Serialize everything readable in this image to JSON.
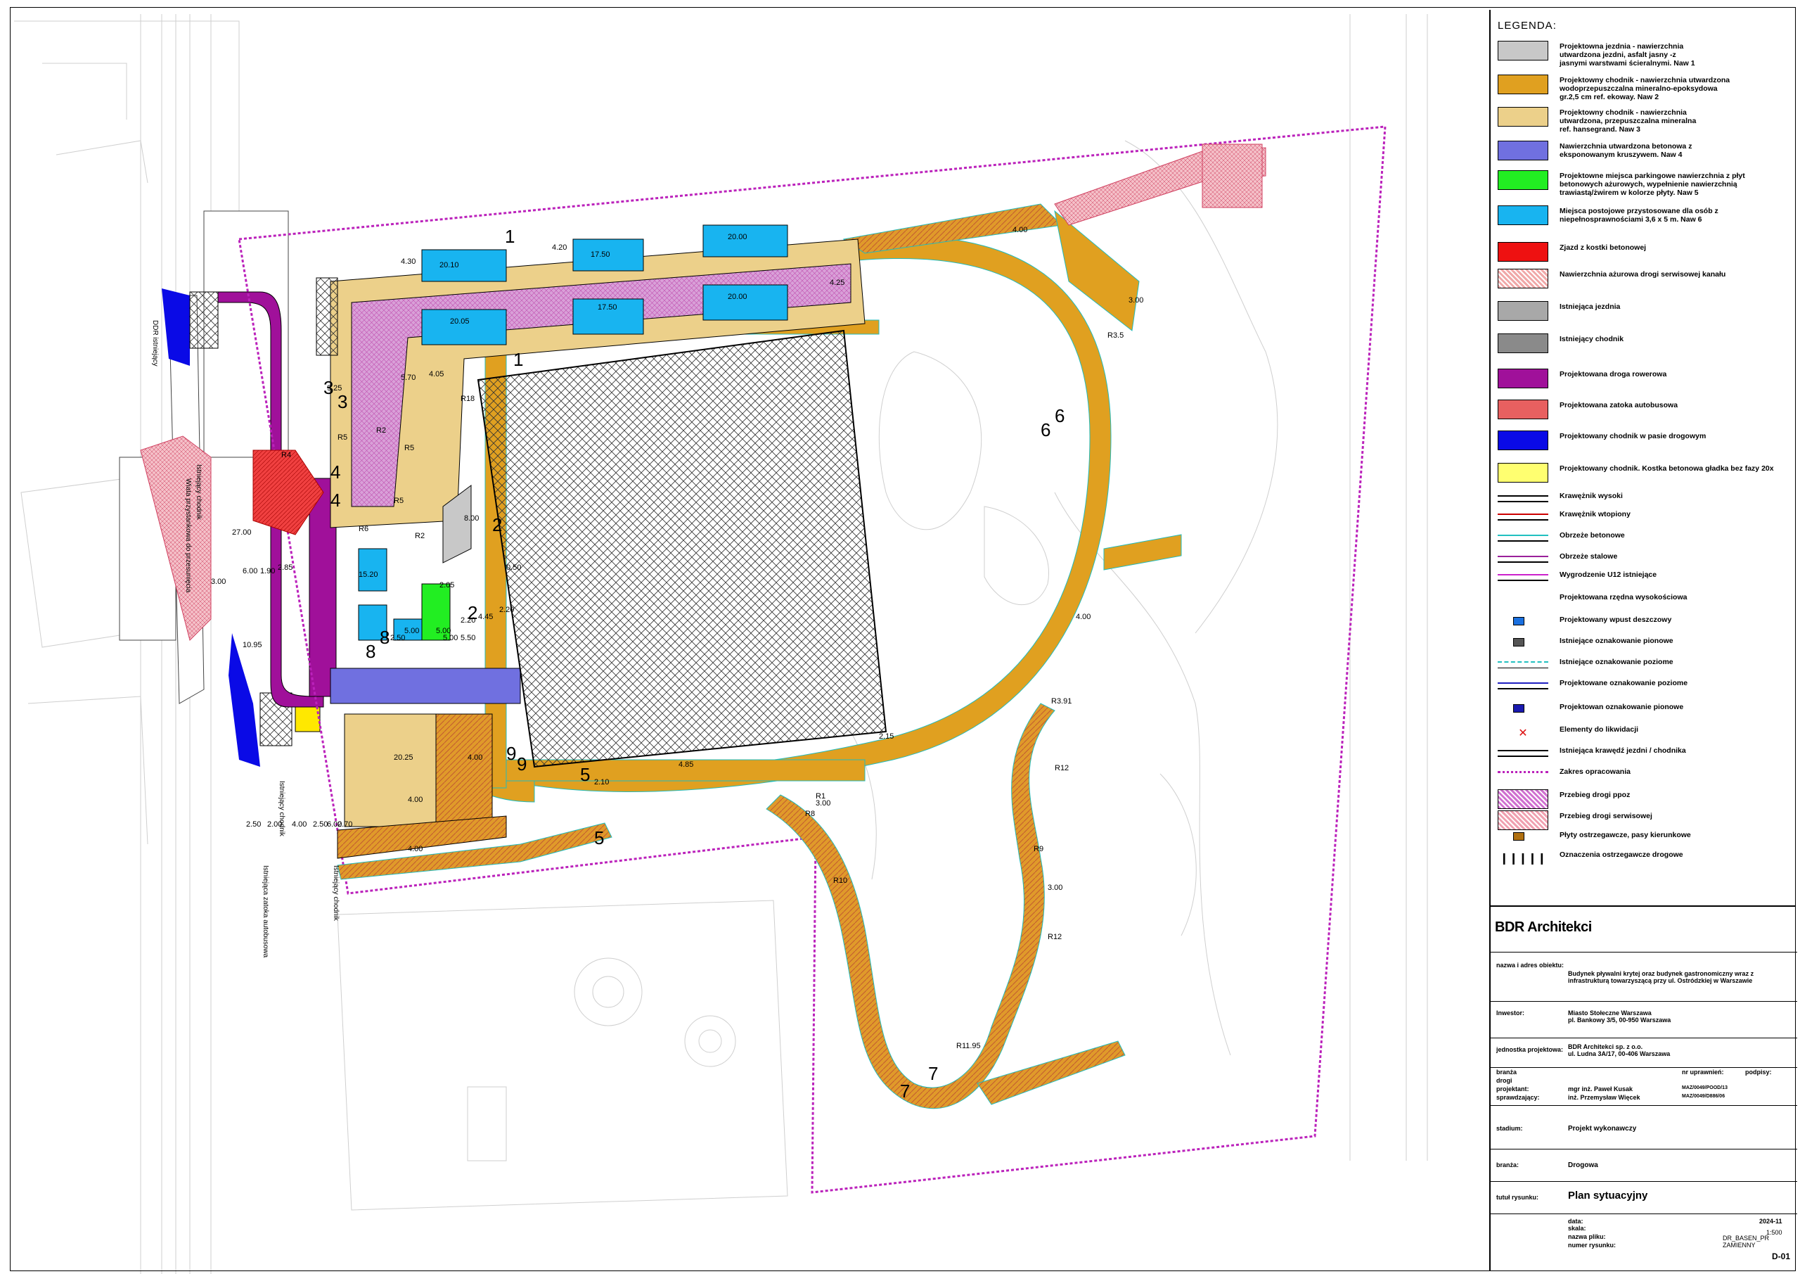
{
  "legend": {
    "title": "LEGENDA:",
    "items": [
      {
        "label": "Projektowna jezdnia - nawierzchnia\nutwardzona jezdni, asfalt jasny -z\njasnymi warstwami ścieralnymi. Naw 1",
        "color": "#c8c8c8",
        "kind": "box"
      },
      {
        "label": "Projektowny chodnik - nawierzchnia utwardzona\nwodoprzepuszczalna mineralno-epoksydowa\ngr.2,5 cm ref. ekoway. Naw 2",
        "color": "#e0a020",
        "kind": "box"
      },
      {
        "label": "Projektowny chodnik - nawierzchnia\nutwardzona, przepuszczalna mineralna\nref. hansegrand. Naw 3",
        "color": "#ecd08a",
        "kind": "box"
      },
      {
        "label": "Nawierzchnia utwardzona betonowa z\neksponowanym kruszywem. Naw 4",
        "color": "#7070e0",
        "kind": "box"
      },
      {
        "label": "Projektowne miejsca parkingowe nawierzchnia z płyt\nbetonowych ażurowych, wypełnienie nawierzchnią\ntrawiastą/żwirem w kolorze płyty. Naw 5",
        "color": "#22ee22",
        "kind": "box"
      },
      {
        "label": "Miejsca postojowe przystosowane dla osób z\nniepełnosprawnościami 3,6 x 5 m. Naw 6",
        "color": "#18b4f0",
        "kind": "box"
      },
      {
        "label": "Zjazd z kostki betonowej",
        "color": "#ee1111",
        "kind": "box"
      },
      {
        "label": "Nawierzchnia ażurowa drogi serwisowej kanału",
        "color": "#f0a8a8",
        "kind": "hatch"
      },
      {
        "label": "Istniejąca jezdnia",
        "color": "#a8a8a8",
        "kind": "box"
      },
      {
        "label": "Istniejący chodnik",
        "color": "#8a8a8a",
        "kind": "box"
      },
      {
        "label": "Projektowana droga rowerowa",
        "color": "#a0109a",
        "kind": "box"
      },
      {
        "label": "Projektowana zatoka autobusowa",
        "color": "#e86060",
        "kind": "box"
      },
      {
        "label": "Projektowany chodnik w pasie drogowym",
        "color": "#0a0ae6",
        "kind": "box"
      },
      {
        "label": "Projektowany chodnik. Kostka betonowa gładka bez fazy 20x",
        "color": "#ffff70",
        "kind": "box"
      },
      {
        "label": "Krawężnik wysoki",
        "color": "#000000",
        "kind": "line2"
      },
      {
        "label": "Krawężnik wtopiony",
        "color": "#cc0000",
        "kind": "line2"
      },
      {
        "label": "Obrzeże betonowe",
        "color": "#22c0c0",
        "kind": "line2"
      },
      {
        "label": "Obrzeże stalowe",
        "color": "#9a209a",
        "kind": "line2"
      },
      {
        "label": "Wygrodzenie U12 istniejące",
        "color": "#cc22cc",
        "kind": "line2"
      },
      {
        "label": "Projektowana rzędna wysokościowa",
        "color": "#000000",
        "kind": "none"
      },
      {
        "label": "Projektowany wpust deszczowy",
        "color": "#1a70e0",
        "kind": "icon"
      },
      {
        "label": "Istniejące oznakowanie pionowe",
        "color": "#555555",
        "kind": "icon"
      },
      {
        "label": "Istniejące oznakowanie poziome",
        "color": "#22c0c0",
        "kind": "dash"
      },
      {
        "label": "Projektowane oznakowanie poziome",
        "color": "#2020c0",
        "kind": "line2"
      },
      {
        "label": "Projektowan oznakowanie pionowe",
        "color": "#1a1ab0",
        "kind": "icon"
      },
      {
        "label": "Elementy do likwidacji",
        "color": "#dd1111",
        "kind": "cross"
      },
      {
        "label": "Istniejąca krawędź jezdni / chodnika",
        "color": "#000000",
        "kind": "line2"
      },
      {
        "label": "Zakres opracowania",
        "color": "#bb22bb",
        "kind": "dotted"
      },
      {
        "label": "Przebieg drogi ppoz",
        "color": "#d070d0",
        "kind": "hatchbox"
      },
      {
        "label": "Przebieg drogi serwisowej",
        "color": "#f0a0b0",
        "kind": "hatchbox"
      },
      {
        "label": "Płyty ostrzegawcze, pasy kierunkowe",
        "color": "#b07010",
        "kind": "icon"
      },
      {
        "label": "Oznaczenia ostrzegawcze drogowe",
        "color": "#000000",
        "kind": "bars"
      }
    ]
  },
  "title_block": {
    "firm": "BDR Architekci",
    "object_label": "nazwa i adres obiektu:",
    "object_value": "Budynek pływalni krytej oraz budynek gastronomiczny wraz z\ninfrastrukturą towarzyszącą przy ul. Ostródzkiej w Warszawie",
    "investor_label": "Inwestor:",
    "investor_value": "Miasto Stołeczne Warszawa\npl. Bankowy 3/5, 00-950 Warszawa",
    "unit_label": "jednostka projektowa:",
    "unit_value": "BDR Architekci sp. z o.o.\nul. Ludna 3A/17, 00-406 Warszawa",
    "col_branza": "branża",
    "col_upr": "nr uprawnień:",
    "col_podpis": "podpisy:",
    "row_drogi": "drogi",
    "projektant_label": "projektant:",
    "projektant_name": "mgr inż. Paweł Kusak",
    "projektant_nr": "MAZ/0049/POOD/13",
    "sprawdzajacy_label": "sprawdzający:",
    "sprawdzajacy_name": "inż. Przemysław Więcek",
    "sprawdzajacy_nr": "MAZ/0049/D886/06",
    "stadium_label": "stadium:",
    "stadium_value": "Projekt wykonawczy",
    "branza_label": "branża:",
    "branza_value": "Drogowa",
    "tytul_label": "tutuł rysunku:",
    "tytul_value": "Plan sytuacyjny",
    "data_label": "data:",
    "data_value": "2024-11",
    "skala_label": "skala:",
    "skala_value": "1:500",
    "plik_label": "nazwa pliku:",
    "plik_value": "DR_BASEN_PR ZAMIENNY",
    "numer_label": "numer rysunku:",
    "numer_value": "D-01"
  },
  "map_labels": {
    "dims": [
      "20.10",
      "17.50",
      "20.00",
      "4.30",
      "4.20",
      "20.05",
      "17.50",
      "20.00",
      "4.25",
      "5.70",
      "4.05",
      "9.25",
      "R18",
      "R5",
      "R5",
      "R2",
      "R2",
      "R6",
      "R5",
      "R4",
      "8.00",
      "15.20",
      "5.00",
      "5.00",
      "4.45",
      "2.20",
      "27.00",
      "10.95",
      "6.00",
      "1.90",
      "2.85",
      "3.00",
      "20.25",
      "4.00",
      "4.00",
      "4.00",
      "2.10",
      "4.85",
      "2.15",
      "R1",
      "R8",
      "R3.91",
      "R12",
      "R9",
      "R10",
      "R12",
      "R11.95",
      "3.00",
      "3.00",
      "4.00",
      "4.00",
      "3.00",
      "R3.5",
      "2.70",
      "2.50",
      "2.00",
      "4.00",
      "2.50",
      "6.00",
      "2.05",
      "5.50",
      "0.50",
      "2.20",
      "2.50",
      "5.00",
      "5.00",
      "5.00"
    ],
    "section_marks": [
      "1",
      "1",
      "2",
      "2",
      "3",
      "3",
      "4",
      "4",
      "5",
      "5",
      "6",
      "6",
      "7",
      "7",
      "8",
      "8",
      "9",
      "9"
    ],
    "street_labels": [
      "Istniejący chodnik",
      "Wiata przystankowa do przesunięcia",
      "DDR istniejący",
      "Istniejący chodnik",
      "Istniejąca zatoka autobusowa",
      "Istniejący chodnik"
    ]
  }
}
